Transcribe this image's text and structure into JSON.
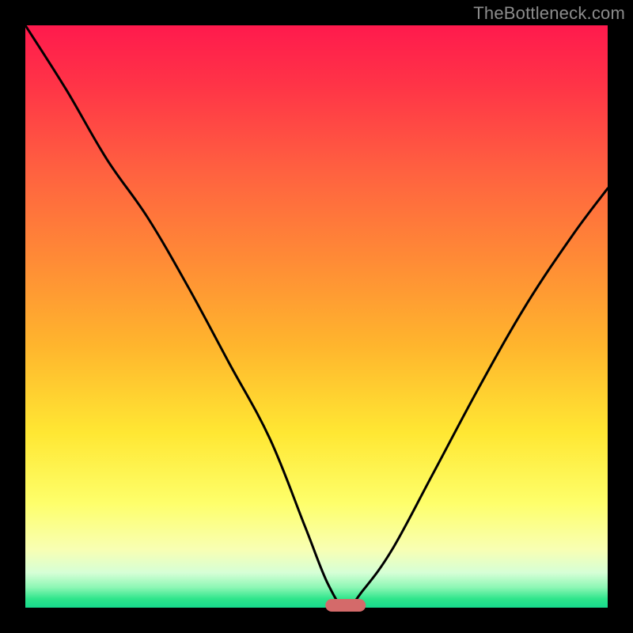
{
  "watermark": "TheBottleneck.com",
  "colors": {
    "frame": "#000000",
    "curve": "#000000",
    "marker": "#d46a6a",
    "gradient_top": "#ff1a4d",
    "gradient_bottom": "#17d98d"
  },
  "chart_data": {
    "type": "line",
    "title": "",
    "xlabel": "",
    "ylabel": "",
    "xlim": [
      0,
      100
    ],
    "ylim": [
      0,
      100
    ],
    "grid": false,
    "legend": false,
    "marker": {
      "x": 55,
      "y": 0,
      "width_pct": 7
    },
    "series": [
      {
        "name": "bottleneck-curve",
        "x": [
          0,
          7,
          14,
          21,
          28,
          35,
          42,
          48,
          52,
          55,
          58,
          63,
          70,
          78,
          86,
          94,
          100
        ],
        "values": [
          100,
          89,
          77,
          67,
          55,
          42,
          29,
          14,
          4,
          0,
          3,
          10,
          23,
          38,
          52,
          64,
          72
        ]
      }
    ]
  }
}
